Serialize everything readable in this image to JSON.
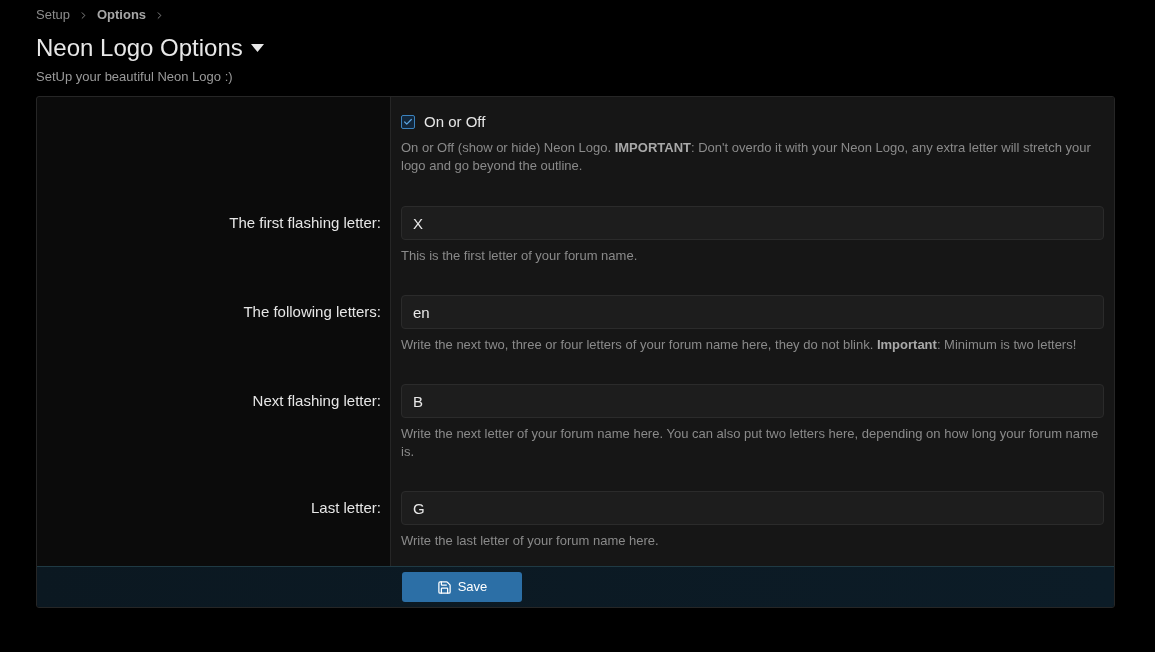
{
  "breadcrumb": [
    {
      "label": "Setup",
      "current": false
    },
    {
      "label": "Options",
      "current": true
    }
  ],
  "header": {
    "title": "Neon Logo Options",
    "description": "SetUp your beautiful Neon Logo :)"
  },
  "options": [
    {
      "kind": "checkbox",
      "label": "On or Off",
      "checked": true,
      "hint": "On or Off (show or hide) Neon Logo. **IMPORTANT**: Don't overdo it with your Neon Logo, any extra letter will stretch your logo and go beyond the outline."
    },
    {
      "kind": "text",
      "label": "The first flashing letter:",
      "value": "X",
      "hint": "This is the first letter of your forum name."
    },
    {
      "kind": "text",
      "label": "The following letters:",
      "value": "en",
      "hint": "Write the next two, three or four letters of your forum name here, they do not blink. **Important**: Minimum is two letters!"
    },
    {
      "kind": "text",
      "label": "Next flashing letter:",
      "value": "B",
      "hint": "Write the next letter of your forum name here. You can also put two letters here, depending on how long your forum name is."
    },
    {
      "kind": "text",
      "label": "Last letter:",
      "value": "G",
      "hint": "Write the last letter of your forum name here."
    }
  ],
  "footer": {
    "save_button": "Save"
  }
}
